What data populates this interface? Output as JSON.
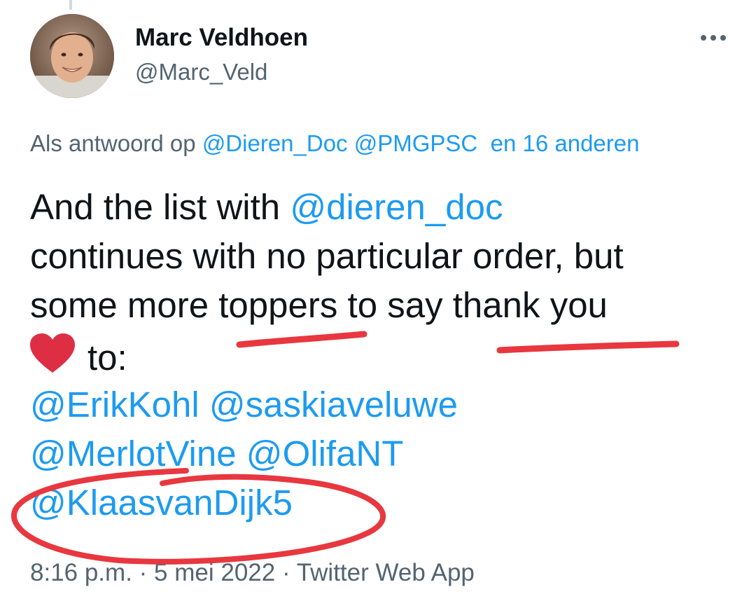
{
  "author": {
    "display_name": "Marc Veldhoen",
    "handle": "@Marc_Veld"
  },
  "reply": {
    "prefix": "Als antwoord op",
    "mentions": [
      "@Dieren_Doc",
      "@PMGPSC"
    ],
    "others": "en 16 anderen"
  },
  "tweet": {
    "line1_text": "And the list with ",
    "line1_mention": "@dieren_doc",
    "line2": "continues with no particular order, but",
    "line3": "some more toppers to say thank you",
    "line4": "to:",
    "mentions_row1": [
      "@ErikKohl",
      "@saskiaveluwe"
    ],
    "mentions_row2": [
      "@MerlotVine",
      "@OlifaNT"
    ],
    "mentions_row3": [
      "@KlaasvanDijk5"
    ]
  },
  "meta": {
    "time": "8:16 p.m.",
    "date": "5 mei 2022",
    "source": "Twitter Web App",
    "separator": "·"
  },
  "icons": {
    "more": "more-options-icon",
    "heart": "red-heart-emoji"
  },
  "colors": {
    "link": "#1d9bf0",
    "text": "#0f1419",
    "secondary": "#536471",
    "annotation": "#e8373f"
  }
}
